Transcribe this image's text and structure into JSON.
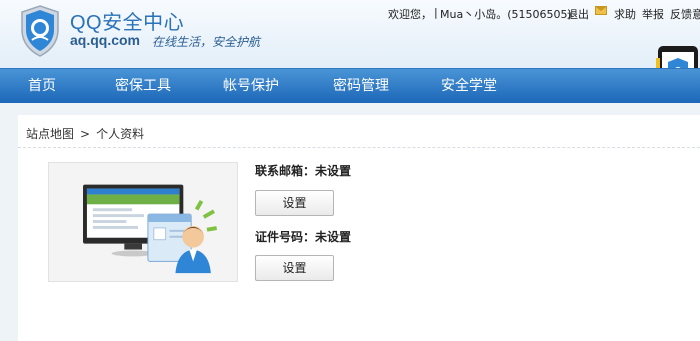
{
  "brand": {
    "title": "QQ安全中心",
    "url": "aq.qq.com",
    "slogan": "在线生活，安全护航"
  },
  "topbar": {
    "welcome": "欢迎您，",
    "separator": "|",
    "user": "Mua丶小岛。(51506505)",
    "logout": "退出",
    "help": "求助",
    "report": "举报",
    "feedback": "反馈意"
  },
  "nav": {
    "items": [
      "首页",
      "密保工具",
      "帐号保护",
      "密码管理",
      "安全学堂"
    ]
  },
  "breadcrumb": {
    "root": "站点地图",
    "separator": ">",
    "current": "个人资料"
  },
  "profile": {
    "email_label": "联系邮箱：未设置",
    "email_button": "设置",
    "id_label": "证件号码：未设置",
    "id_button": "设置"
  },
  "colors": {
    "nav_top": "#4a94d6",
    "nav_bottom": "#1c67b8",
    "brand_blue": "#2a72b9"
  }
}
